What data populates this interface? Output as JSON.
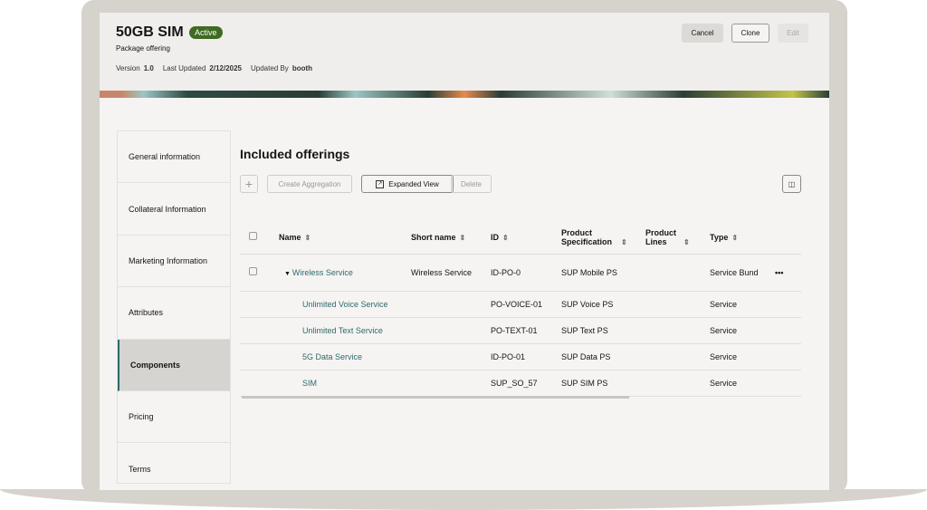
{
  "header": {
    "title": "50GB SIM",
    "status": "Active",
    "subtitle": "Package offering",
    "version_label": "Version",
    "version": "1.0",
    "last_updated_label": "Last Updated",
    "last_updated": "2/12/2025",
    "updated_by_label": "Updated By",
    "updated_by": "booth",
    "cancel": "Cancel",
    "clone": "Clone",
    "edit": "Edit"
  },
  "sidebar": {
    "items": [
      {
        "label": "General information"
      },
      {
        "label": "Collateral Information"
      },
      {
        "label": "Marketing Information"
      },
      {
        "label": "Attributes"
      },
      {
        "label": "Components"
      },
      {
        "label": "Pricing"
      },
      {
        "label": "Terms"
      }
    ]
  },
  "main": {
    "title": "Included offerings",
    "toolbar": {
      "add": "+",
      "create_aggregation": "Create Aggregation",
      "expanded_view": "Expanded View",
      "delete": "Delete"
    },
    "columns": [
      "Name",
      "Short name",
      "ID",
      "Product Specification",
      "Product Lines",
      "Type"
    ],
    "rows": [
      {
        "name": "Wireless Service",
        "short": "Wireless Service",
        "id": "ID-PO-0",
        "spec": "SUP Mobile PS",
        "lines": "",
        "type": "Service Bund"
      },
      {
        "name": "Unlimited Voice Service",
        "short": "",
        "id": "PO-VOICE-01",
        "spec": "SUP Voice PS",
        "lines": "",
        "type": "Service"
      },
      {
        "name": "Unlimited Text Service",
        "short": "",
        "id": "PO-TEXT-01",
        "spec": "SUP Text PS",
        "lines": "",
        "type": "Service"
      },
      {
        "name": "5G Data Service",
        "short": "",
        "id": "ID-PO-01",
        "spec": "SUP Data PS",
        "lines": "",
        "type": "Service"
      },
      {
        "name": "SIM",
        "short": "",
        "id": "SUP_SO_57",
        "spec": "SUP SIM PS",
        "lines": "",
        "type": "Service"
      }
    ]
  },
  "colors": {
    "accent": "#2e6a6c",
    "badge": "#3f6b22"
  }
}
